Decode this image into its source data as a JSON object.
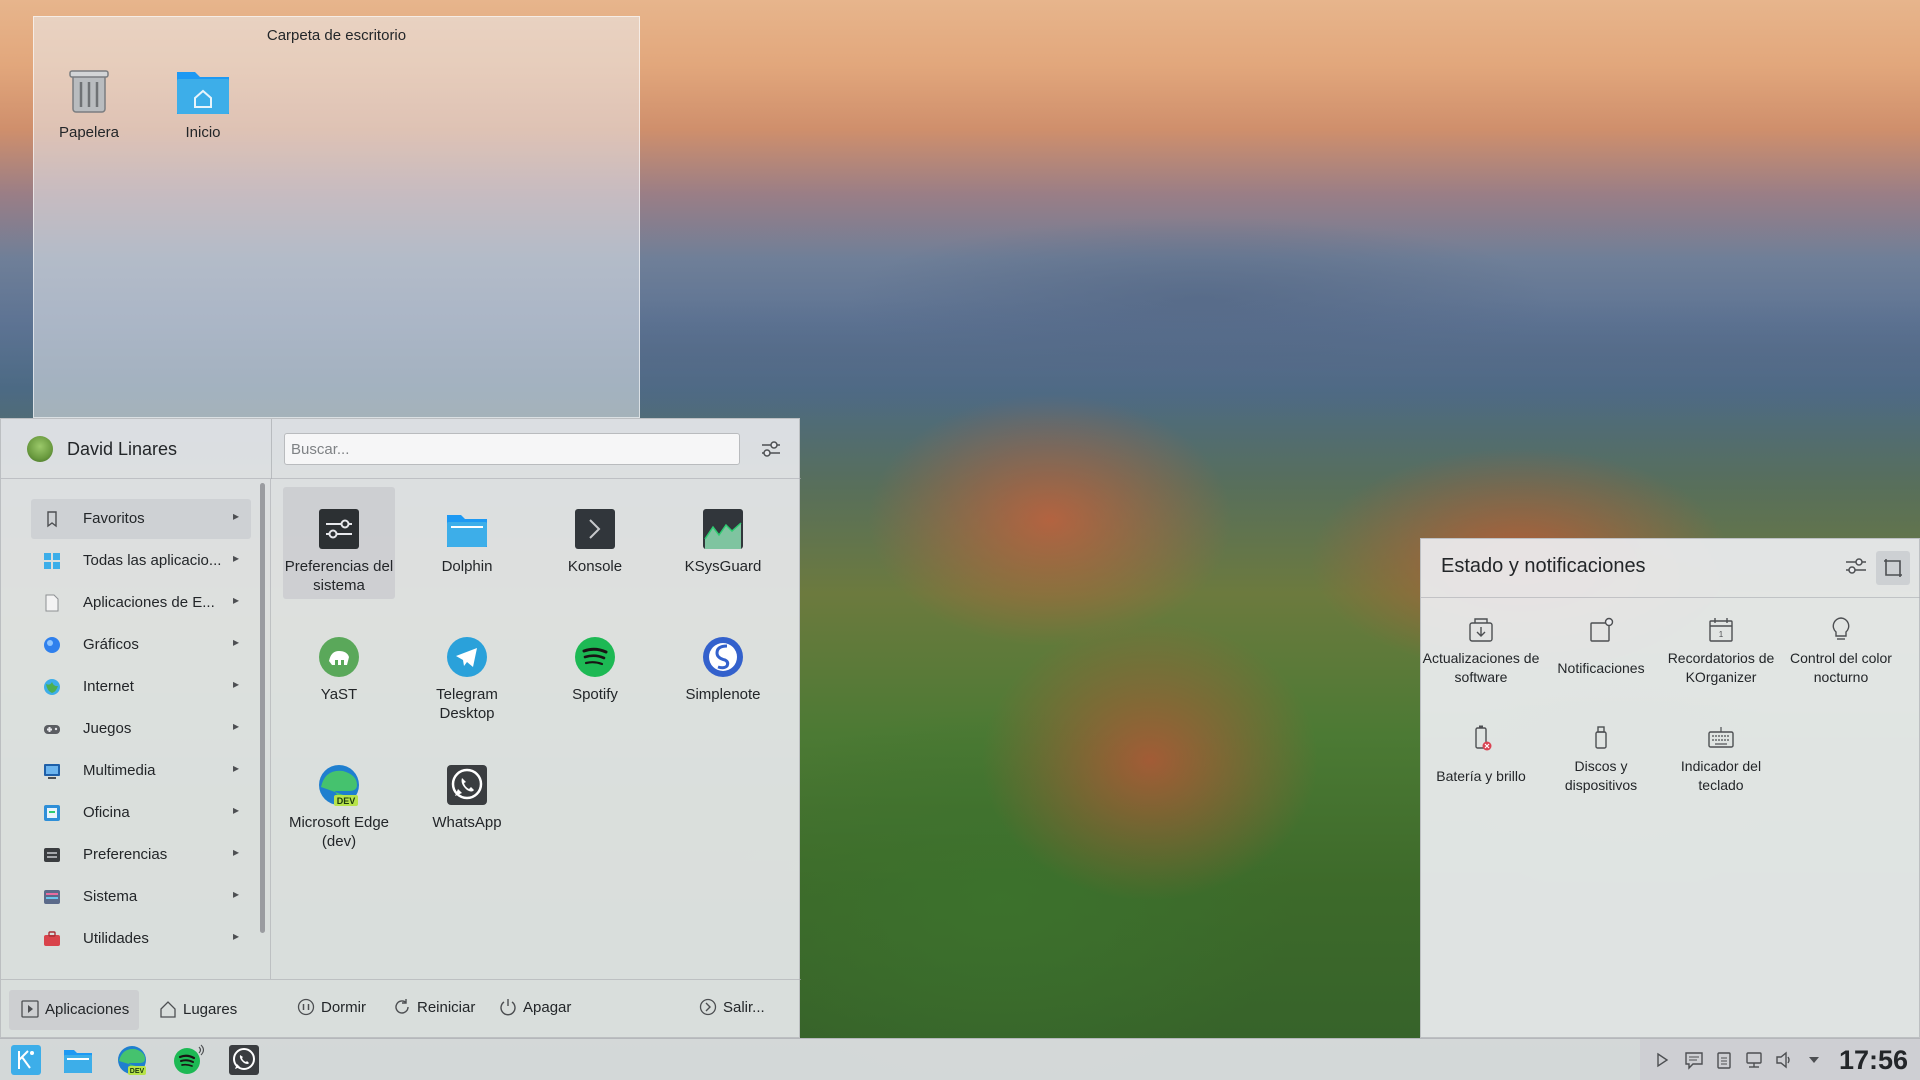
{
  "desktop_folder": {
    "title": "Carpeta de escritorio",
    "icons": [
      {
        "label": "Papelera",
        "icon": "trash-icon"
      },
      {
        "label": "Inicio",
        "icon": "home-folder-icon"
      }
    ]
  },
  "launcher": {
    "user_name": "David Linares",
    "search": {
      "placeholder": "Buscar...",
      "value": ""
    },
    "categories": [
      {
        "label": "Favoritos",
        "icon": "bookmark-icon",
        "active": true
      },
      {
        "label": "Todas las aplicacio...",
        "icon": "grid-icon"
      },
      {
        "label": "Aplicaciones de E...",
        "icon": "document-icon"
      },
      {
        "label": "Gráficos",
        "icon": "graphics-icon"
      },
      {
        "label": "Internet",
        "icon": "globe-icon"
      },
      {
        "label": "Juegos",
        "icon": "gamepad-icon"
      },
      {
        "label": "Multimedia",
        "icon": "multimedia-icon"
      },
      {
        "label": "Oficina",
        "icon": "office-icon"
      },
      {
        "label": "Preferencias",
        "icon": "preferences-icon"
      },
      {
        "label": "Sistema",
        "icon": "system-icon"
      },
      {
        "label": "Utilidades",
        "icon": "utilities-icon"
      }
    ],
    "apps": [
      {
        "label": "Preferencias del sistema",
        "icon": "system-settings-icon",
        "active": true
      },
      {
        "label": "Dolphin",
        "icon": "dolphin-folder-icon"
      },
      {
        "label": "Konsole",
        "icon": "terminal-icon"
      },
      {
        "label": "KSysGuard",
        "icon": "system-monitor-icon"
      },
      {
        "label": "YaST",
        "icon": "yast-icon"
      },
      {
        "label": "Telegram Desktop",
        "icon": "telegram-icon"
      },
      {
        "label": "Spotify",
        "icon": "spotify-icon"
      },
      {
        "label": "Simplenote",
        "icon": "simplenote-icon"
      },
      {
        "label": "Microsoft Edge (dev)",
        "icon": "edge-dev-icon"
      },
      {
        "label": "WhatsApp",
        "icon": "whatsapp-icon"
      }
    ],
    "footer": {
      "tab_apps": "Aplicaciones",
      "tab_places": "Lugares",
      "sleep": "Dormir",
      "restart": "Reiniciar",
      "shutdown": "Apagar",
      "logout": "Salir..."
    }
  },
  "tray_popup": {
    "title": "Estado y notificaciones",
    "items": [
      {
        "label": "Actualizaciones de software",
        "icon": "software-update-icon"
      },
      {
        "label": "Notificaciones",
        "icon": "notifications-icon"
      },
      {
        "label": "Recordatorios de KOrganizer",
        "icon": "calendar-icon"
      },
      {
        "label": "Control del color nocturno",
        "icon": "bulb-icon"
      },
      {
        "label": "Batería y brillo",
        "icon": "battery-icon"
      },
      {
        "label": "Discos y dispositivos",
        "icon": "usb-drive-icon"
      },
      {
        "label": "Indicador del teclado",
        "icon": "keyboard-icon"
      }
    ]
  },
  "taskbar": {
    "tasks": [
      {
        "name": "app-launcher",
        "icon": "launcher-icon"
      },
      {
        "name": "dolphin",
        "icon": "folder-icon"
      },
      {
        "name": "edge-dev",
        "icon": "edge-dev-icon"
      },
      {
        "name": "spotify",
        "icon": "spotify-icon"
      },
      {
        "name": "whatsapp",
        "icon": "whatsapp-icon"
      }
    ],
    "clock": "17:56"
  },
  "colors": {
    "folder_blue": "#3daee9",
    "spotify_green": "#1db954",
    "whatsapp_green": "#25d366",
    "telegram_blue": "#2aa1da",
    "yast_green": "#5aa85a",
    "simplenote_blue": "#3361cc"
  }
}
